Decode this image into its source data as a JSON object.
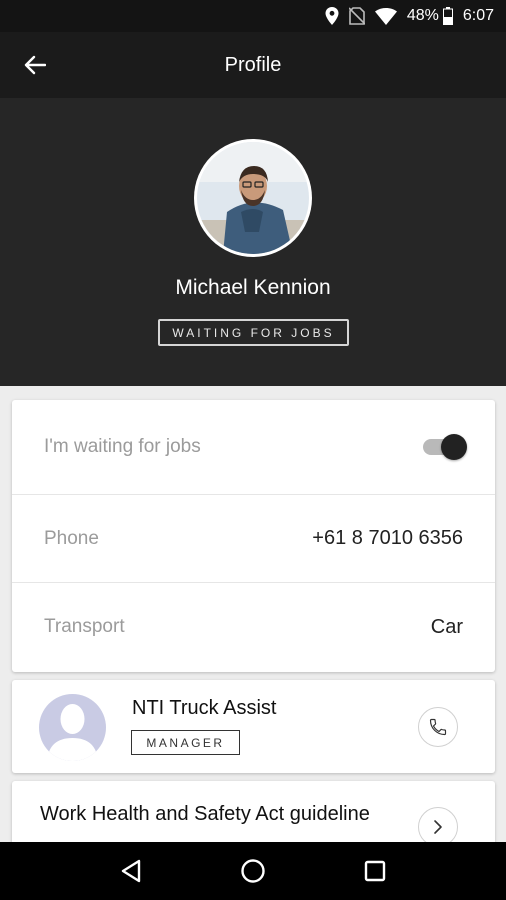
{
  "status_bar": {
    "battery": "48%",
    "time": "6:07"
  },
  "appbar": {
    "title": "Profile"
  },
  "profile": {
    "name": "Michael Kennion",
    "status": "WAITING FOR JOBS"
  },
  "info": {
    "rows": [
      {
        "label": "I'm waiting for jobs",
        "toggle_on": true
      },
      {
        "label": "Phone",
        "value": "+61 8 7010 6356"
      },
      {
        "label": "Transport",
        "value": "Car"
      }
    ]
  },
  "contact": {
    "name": "NTI Truck Assist",
    "role": "MANAGER"
  },
  "documents": {
    "title": "Work Health and Safety Act guideline"
  },
  "colors": {
    "header_bg": "#262626",
    "appbar_bg": "#1b1b1b",
    "avatar_placeholder": "#c9cbe4"
  }
}
